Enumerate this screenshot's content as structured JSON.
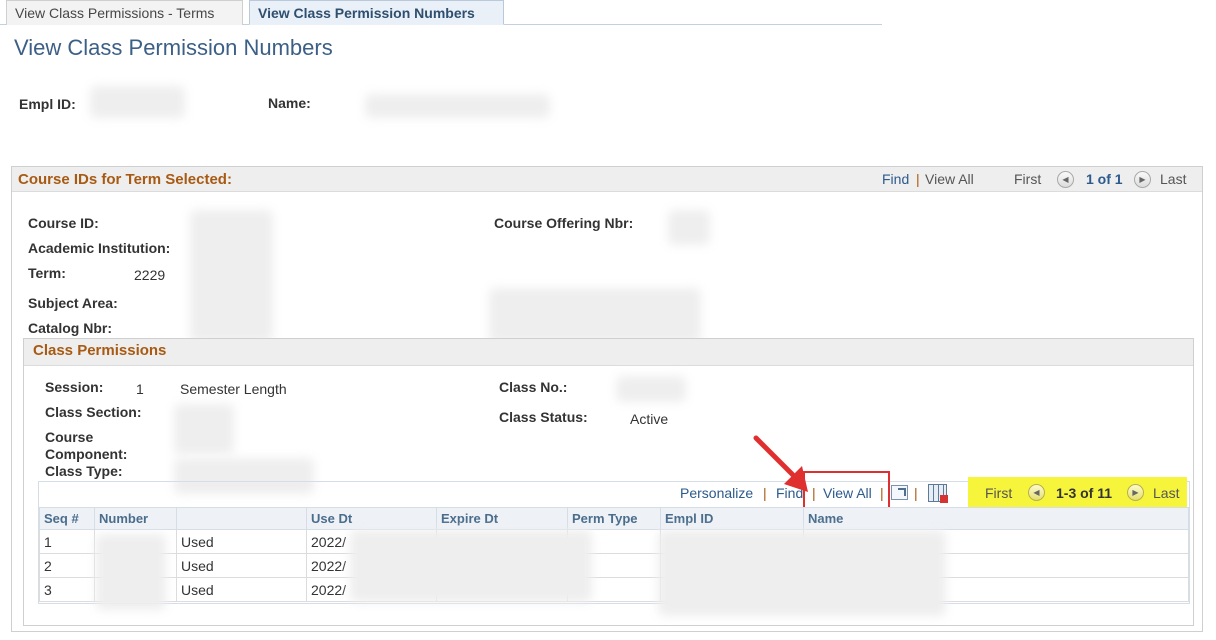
{
  "tabs": [
    {
      "label": "View Class Permissions - Terms",
      "active": false
    },
    {
      "label": "View Class Permission Numbers",
      "active": true
    }
  ],
  "page_title": "View Class Permission Numbers",
  "header": {
    "empl_id_label": "Empl ID:",
    "name_label": "Name:"
  },
  "course_section": {
    "title": "Course IDs for Term Selected:",
    "find_label": "Find",
    "view_all_label": "View All",
    "first_label": "First",
    "count_label": "1 of 1",
    "last_label": "Last",
    "course_id_label": "Course ID:",
    "academic_institution_label": "Academic Institution:",
    "term_label": "Term:",
    "term_value": "2229",
    "subject_area_label": "Subject Area:",
    "catalog_nbr_label": "Catalog Nbr:",
    "course_offering_label": "Course Offering Nbr:"
  },
  "class_permissions": {
    "title": "Class Permissions",
    "session_label": "Session:",
    "session_value": "1",
    "session_desc": "Semester Length",
    "class_section_label": "Class Section:",
    "course_component_label_1": "Course",
    "course_component_label_2": "Component:",
    "class_type_label": "Class Type:",
    "class_no_label": "Class No.:",
    "class_status_label": "Class Status:",
    "class_status_value": "Active"
  },
  "grid_toolbar": {
    "personalize_label": "Personalize",
    "find_label": "Find",
    "view_all_label": "View All",
    "first_label": "First",
    "count_label": "1-3 of 11",
    "last_label": "Last"
  },
  "grid": {
    "columns": [
      "Seq #",
      "Number",
      "",
      "Use Dt",
      "Expire Dt",
      "Perm Type",
      "Empl ID",
      "Name"
    ],
    "rows": [
      {
        "seq": "1",
        "used": "Used",
        "use_dt": "2022/"
      },
      {
        "seq": "2",
        "used": "Used",
        "use_dt": "2022/"
      },
      {
        "seq": "3",
        "used": "Used",
        "use_dt": "2022/"
      }
    ]
  },
  "colors": {
    "title_blue": "#3c5f86",
    "section_orange": "#a85a13",
    "link_blue": "#2c5a8c",
    "highlight_yellow": "#f6f53c",
    "annotation_red": "#e02f2f"
  }
}
